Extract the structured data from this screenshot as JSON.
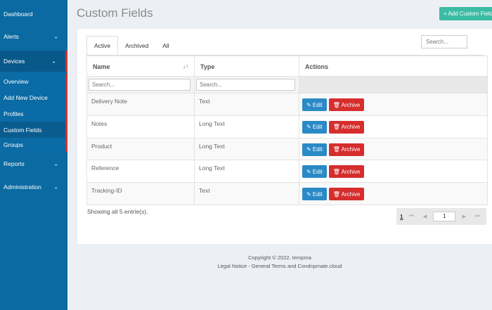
{
  "sidebar": {
    "dashboard": "Dashboard",
    "alerts": "Alerts",
    "devices": "Devices",
    "sub_items": [
      "Overview",
      "Add New Device",
      "Profiles",
      "Custom Fields",
      "Groups"
    ],
    "reports": "Reports",
    "administration": "Administration",
    "chevron": "⌄"
  },
  "header": {
    "title": "Custom Fields",
    "add_button": "+ Add Custom Field"
  },
  "tabs": [
    "Active",
    "Archived",
    "All"
  ],
  "search": {
    "placeholder": "Search..."
  },
  "table": {
    "columns": [
      "Name",
      "Type",
      "Actions"
    ],
    "sort_icon": "↓↑",
    "filter_placeholder": "Search...",
    "rows": [
      {
        "name": "Delivery Note",
        "type": "Text"
      },
      {
        "name": "Notes",
        "type": "Long Text"
      },
      {
        "name": "Product",
        "type": "Long Text"
      },
      {
        "name": "Reference",
        "type": "Long Text"
      },
      {
        "name": "Tracking-ID",
        "type": "Text"
      }
    ],
    "edit_label": "✎ Edit",
    "archive_label": "🗑 Archive"
  },
  "showing_text": "Showing all 5 entrie(s).",
  "pagination": {
    "page": "1",
    "current_input": "1",
    "first_icon": "⏮",
    "prev_icon": "◀",
    "next_icon": "▶",
    "last_icon": "⏭"
  },
  "footer": {
    "copyright": "Copyright © 2022, tempma",
    "links": "Legal Notice - General Terms and Condnpmate.cloud"
  },
  "colors": {
    "sidebar": "#0a6aa1",
    "accent_add": "#3cbca4",
    "edit": "#2a8ac6",
    "archive": "#d62d2d",
    "active_marker": "#d32f2f"
  }
}
